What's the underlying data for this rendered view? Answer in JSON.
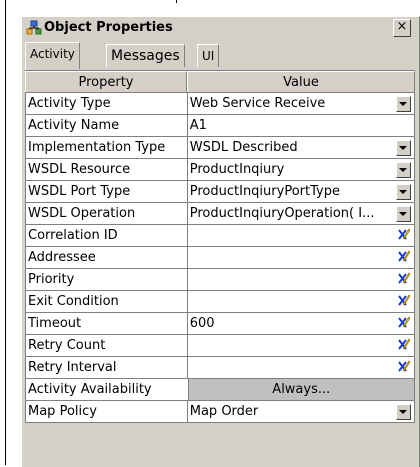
{
  "window": {
    "title": "Object Properties",
    "close_label": "×"
  },
  "tabs": [
    {
      "label": "Activity",
      "active": true
    },
    {
      "label": "Messages",
      "active": false
    },
    {
      "label": "UI",
      "active": false
    }
  ],
  "grid": {
    "header_property": "Property",
    "header_value": "Value",
    "rows": [
      {
        "property": "Activity Type",
        "value": "Web Service Receive",
        "editor": "dropdown"
      },
      {
        "property": "Activity Name",
        "value": "A1",
        "editor": "text"
      },
      {
        "property": "Implementation Type",
        "value": "WSDL Described",
        "editor": "dropdown"
      },
      {
        "property": "WSDL Resource",
        "value": "ProductInqiury",
        "editor": "dropdown"
      },
      {
        "property": "WSDL Port Type",
        "value": "ProductInqiuryPortType",
        "editor": "dropdown"
      },
      {
        "property": "WSDL Operation",
        "value": "ProductInqiuryOperation( I...",
        "editor": "dropdown"
      },
      {
        "property": "Correlation ID",
        "value": "",
        "editor": "expression"
      },
      {
        "property": "Addressee",
        "value": "",
        "editor": "expression"
      },
      {
        "property": "Priority",
        "value": "",
        "editor": "expression"
      },
      {
        "property": "Exit Condition",
        "value": "",
        "editor": "expression"
      },
      {
        "property": "Timeout",
        "value": "600",
        "editor": "expression"
      },
      {
        "property": "Retry Count",
        "value": "",
        "editor": "expression"
      },
      {
        "property": "Retry Interval",
        "value": "",
        "editor": "expression"
      },
      {
        "property": "Activity Availability",
        "value": "Always...",
        "editor": "button"
      },
      {
        "property": "Map Policy",
        "value": "Map Order",
        "editor": "dropdown"
      }
    ]
  },
  "icons": {
    "title_icon": "object-properties-icon",
    "dropdown_icon": "dropdown-arrow-icon",
    "edit_icon": "expression-editor-icon"
  },
  "colors": {
    "panel_bg": "#d4d0c8",
    "grid_line": "#808080",
    "button_bg": "#c0c0c0"
  }
}
